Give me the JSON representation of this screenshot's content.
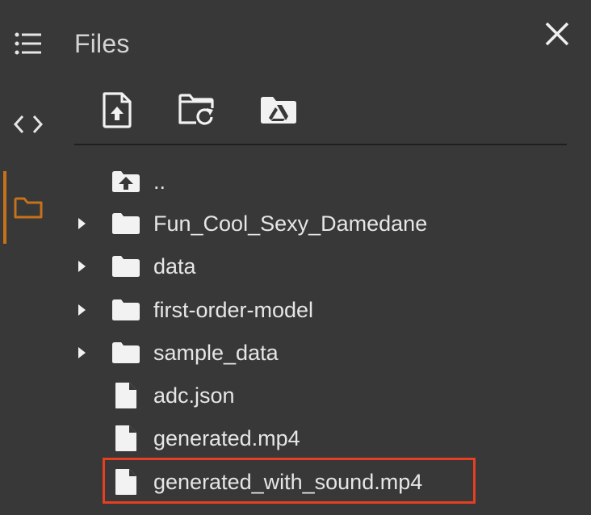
{
  "panel": {
    "title": "Files"
  },
  "rail": {
    "items": [
      {
        "icon": "table-of-contents-icon"
      },
      {
        "icon": "code-snippets-icon"
      },
      {
        "icon": "folder-icon",
        "active": true
      }
    ]
  },
  "toolbar": {
    "items": [
      {
        "icon": "upload-file-icon"
      },
      {
        "icon": "refresh-folder-icon"
      },
      {
        "icon": "mount-drive-icon"
      }
    ]
  },
  "tree": {
    "items": [
      {
        "type": "parent",
        "label": ".."
      },
      {
        "type": "folder",
        "label": "Fun_Cool_Sexy_Damedane",
        "expandable": true
      },
      {
        "type": "folder",
        "label": "data",
        "expandable": true
      },
      {
        "type": "folder",
        "label": "first-order-model",
        "expandable": true
      },
      {
        "type": "folder",
        "label": "sample_data",
        "expandable": true
      },
      {
        "type": "file",
        "label": "adc.json"
      },
      {
        "type": "file",
        "label": "generated.mp4"
      },
      {
        "type": "file",
        "label": "generated_with_sound.mp4",
        "highlighted": true
      }
    ]
  },
  "colors": {
    "background": "#383838",
    "accent": "#c4721b",
    "highlight": "#e63f21",
    "text": "#e6e6e6"
  }
}
